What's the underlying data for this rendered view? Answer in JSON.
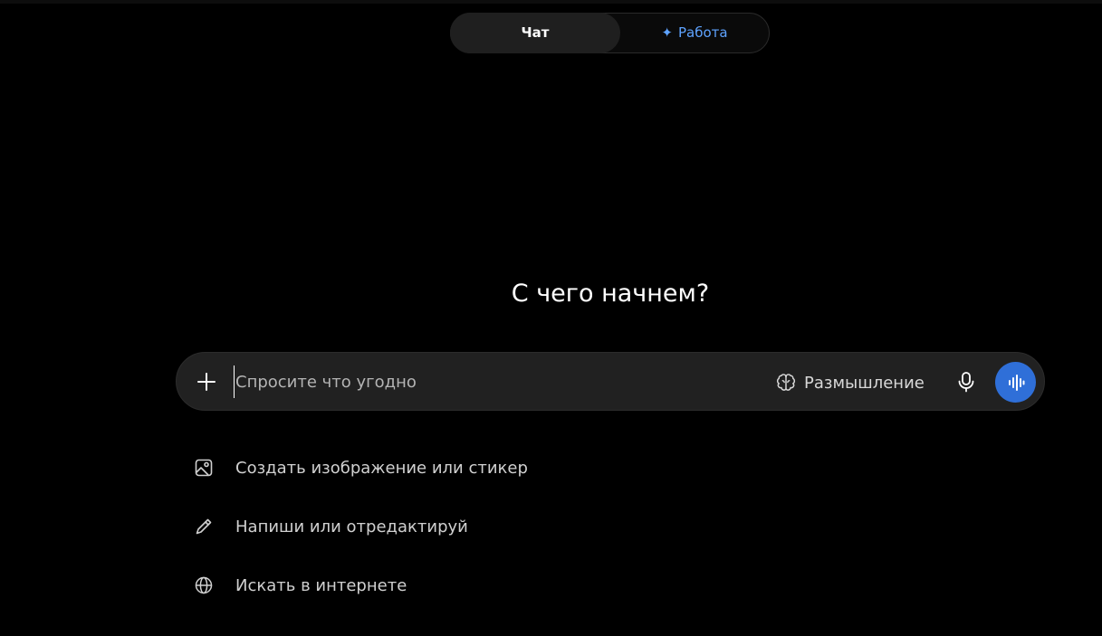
{
  "mode_toggle": {
    "chat_label": "Чат",
    "work_label": "Работа",
    "work_spark": "✦"
  },
  "heading": "С чего начнем?",
  "composer": {
    "placeholder": "Спросите что угодно",
    "think_label": "Размышление",
    "icons": {
      "plus": "plus-icon",
      "think": "brain-icon",
      "mic": "microphone-icon",
      "voice": "voice-wave-icon"
    }
  },
  "suggestions": [
    {
      "label": "Создать изображение или стикер",
      "icon": "image-icon"
    },
    {
      "label": "Напиши или отредактируй",
      "icon": "pencil-icon"
    },
    {
      "label": "Искать в интернете",
      "icon": "globe-icon"
    }
  ],
  "colors": {
    "background": "#000000",
    "composer": "#212121",
    "accent_blue": "#5ea3ff",
    "voice_button": "#2f6fd8"
  }
}
